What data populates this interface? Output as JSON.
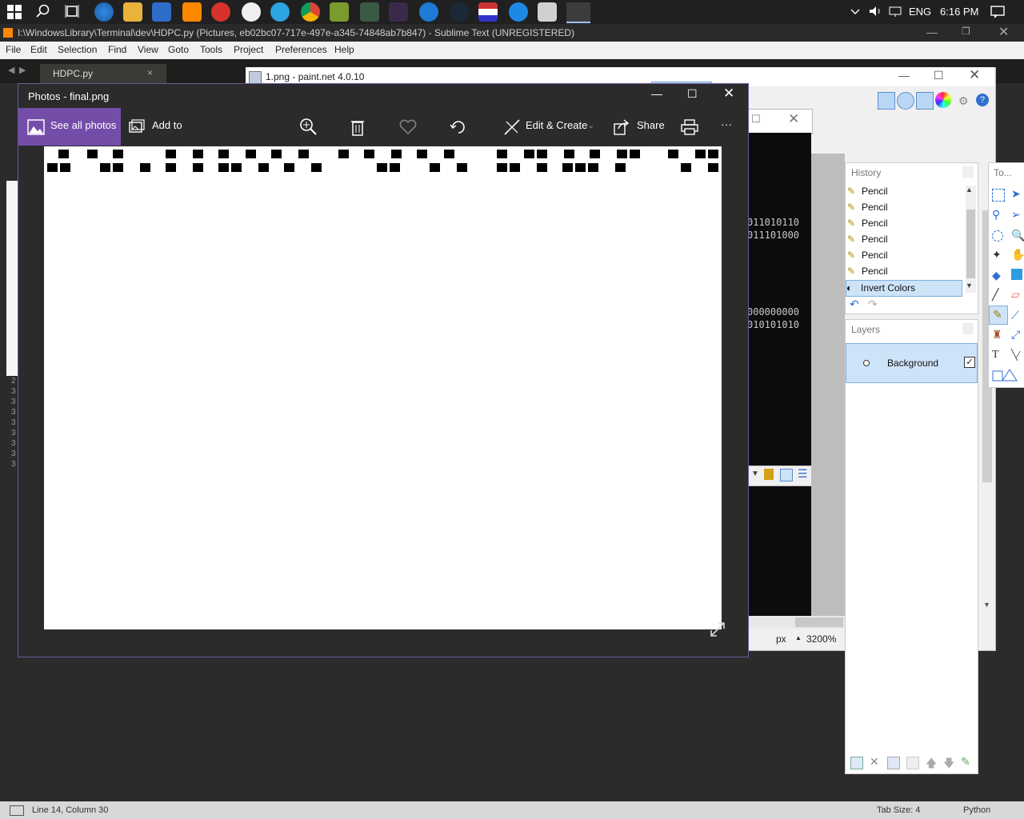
{
  "taskbar": {
    "icons": [
      "windows-icon",
      "search-icon",
      "task-view-icon",
      "globe-app-icon",
      "file-explorer-icon",
      "notepad-app-icon",
      "sublime-text-icon",
      "app-red-icon",
      "clock-app-icon",
      "telegram-icon",
      "chrome-icon",
      "lambda-app-icon",
      "pickaxe-app-icon",
      "x-app-icon",
      "edge-icon",
      "steam-icon",
      "flag-app-icon",
      "drop-app-icon",
      "calculator-icon",
      "photos-icon"
    ],
    "tray": {
      "language": "ENG",
      "time": "6:16 PM"
    }
  },
  "sublime": {
    "title": "I:\\WindowsLibrary\\Terminal\\dev\\HDPC.py (Pictures, eb02bc07-717e-497e-a345-74848ab7b847) - Sublime Text (UNREGISTERED)",
    "menu": [
      "File",
      "Edit",
      "Selection",
      "Find",
      "View",
      "Goto",
      "Tools",
      "Project",
      "Preferences",
      "Help"
    ],
    "tab": {
      "label": "HDPC.py",
      "close": "×"
    },
    "status": {
      "position": "Line 14, Column 30",
      "tab_size": "Tab Size: 4",
      "syntax": "Python"
    }
  },
  "paintnet": {
    "title": "1.png - paint.net 4.0.10",
    "terminal_lines": [
      "011010110",
      "011101000",
      "000000000",
      "010101010"
    ],
    "units": "px",
    "zoom": "3200%",
    "history": {
      "title": "History",
      "items": [
        "Pencil",
        "Pencil",
        "Pencil",
        "Pencil",
        "Pencil",
        "Pencil",
        "Invert Colors"
      ],
      "selected_index": 6
    },
    "layers": {
      "title": "Layers",
      "items": [
        {
          "name": "Background",
          "visible": true
        }
      ]
    },
    "tools_title": "To..."
  },
  "photos": {
    "title": "Photos - final.png",
    "see_all": "See all photos",
    "add_to": "Add to",
    "edit_create": "Edit & Create",
    "share": "Share",
    "more": "···",
    "accent": "#744da9"
  }
}
